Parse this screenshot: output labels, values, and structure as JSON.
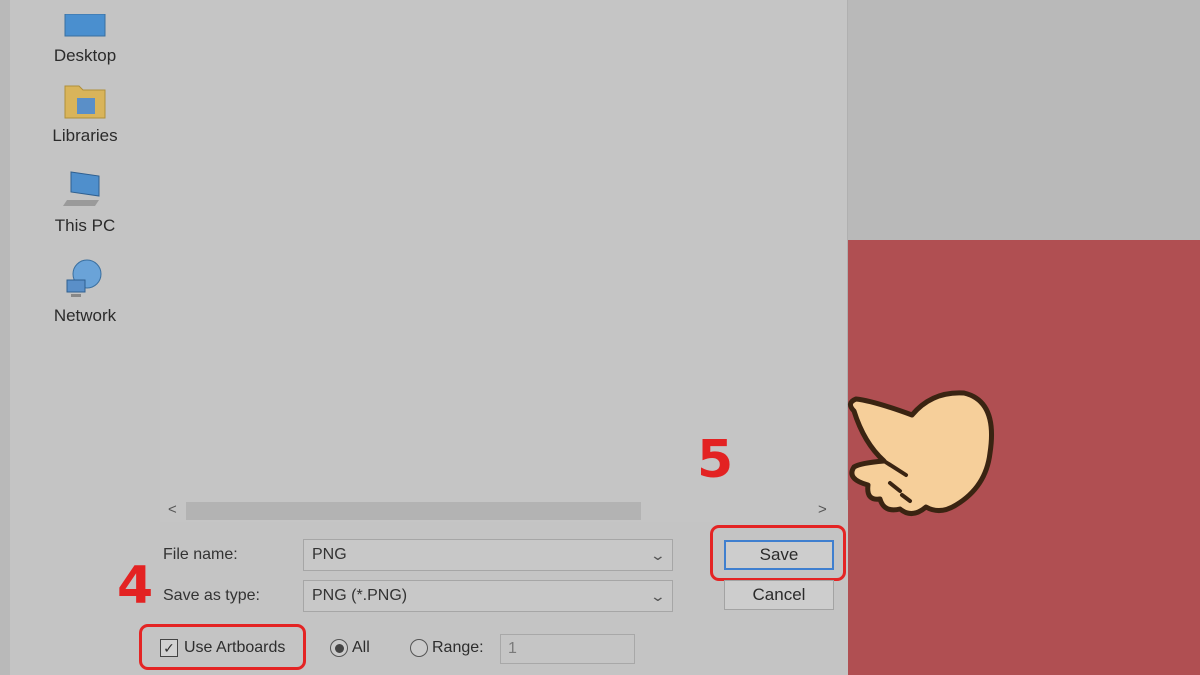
{
  "nav": {
    "items": [
      {
        "label": "Desktop",
        "icon": "desktop-icon"
      },
      {
        "label": "Libraries",
        "icon": "libraries-icon"
      },
      {
        "label": "This PC",
        "icon": "this-pc-icon"
      },
      {
        "label": "Network",
        "icon": "network-icon"
      }
    ]
  },
  "form": {
    "file_name_label": "File name:",
    "file_name_value": "PNG",
    "save_type_label": "Save as type:",
    "save_type_value": "PNG (*.PNG)",
    "use_artboards_label": "Use Artboards",
    "use_artboards_checked": true,
    "all_label": "All",
    "range_label": "Range:",
    "range_value": "1"
  },
  "buttons": {
    "save": "Save",
    "cancel": "Cancel"
  },
  "annotations": {
    "step4": "4",
    "step5": "5"
  },
  "colors": {
    "highlight": "#e42424",
    "panel": "#b04f52",
    "primary_border": "#3f7fcf"
  }
}
